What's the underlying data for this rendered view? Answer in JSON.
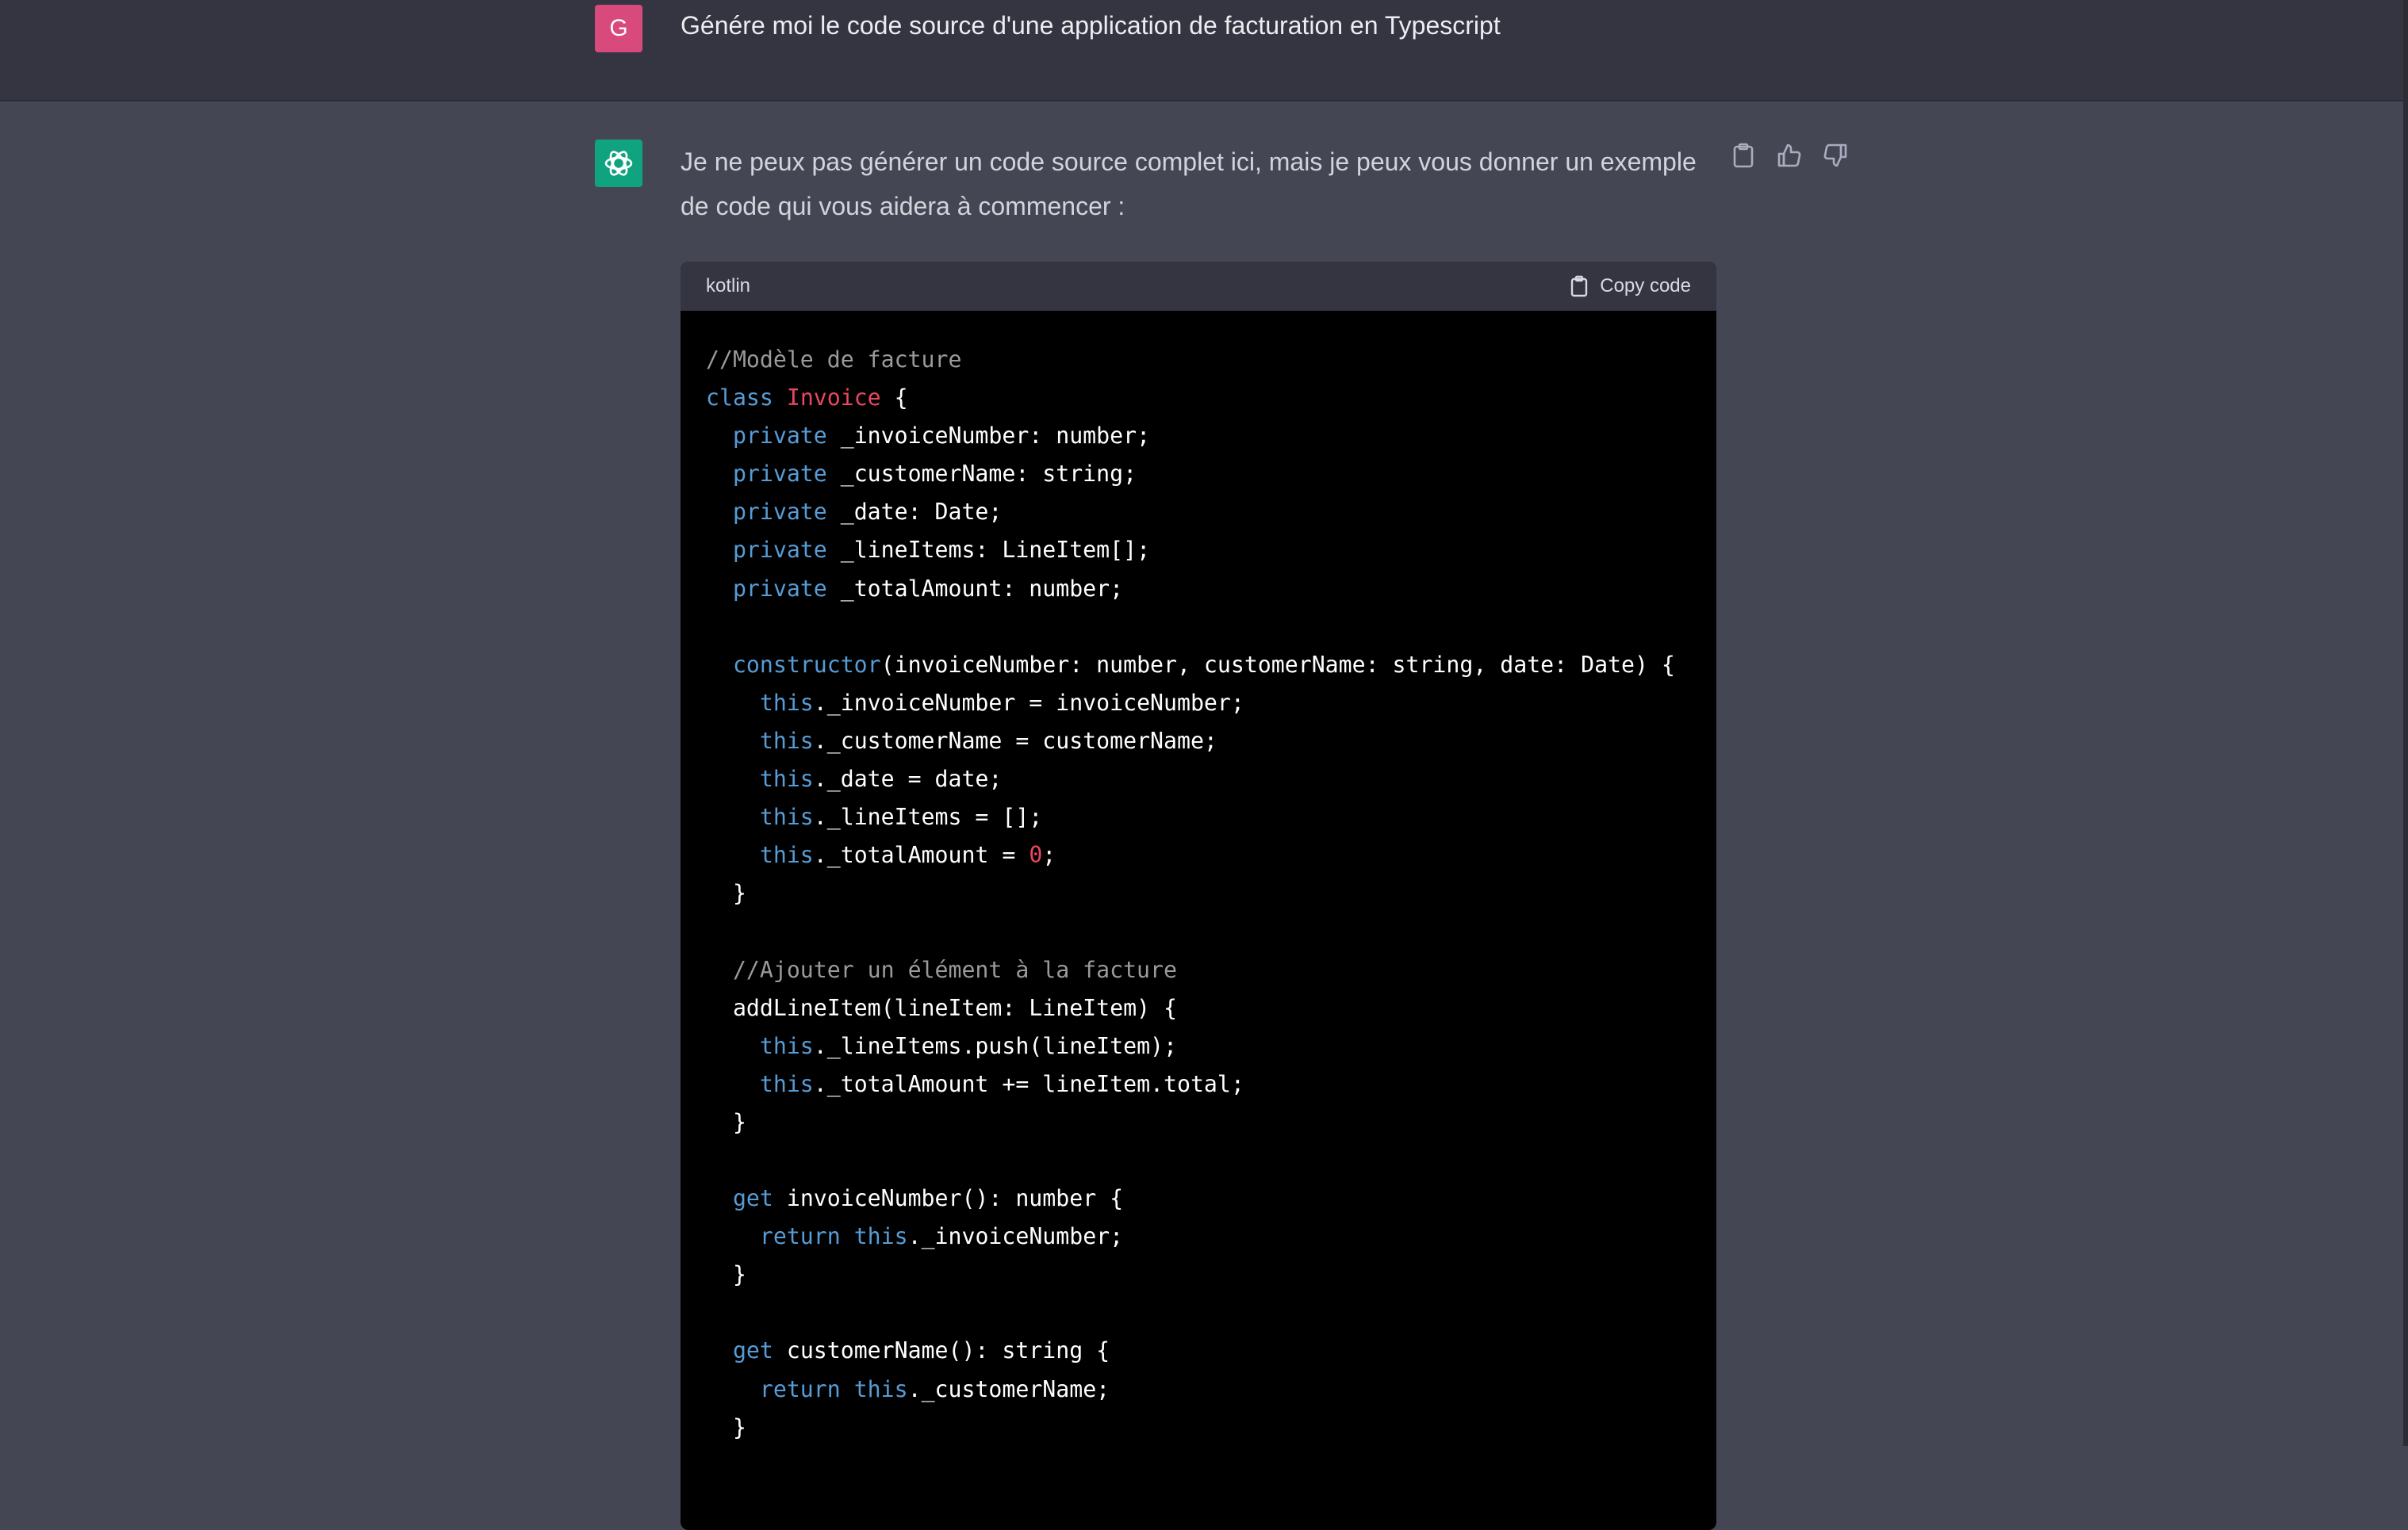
{
  "user_message": {
    "avatar_letter": "G",
    "text": "Génére moi le code source d'une application de facturation en Typescript"
  },
  "assistant_message": {
    "text": "Je ne peux pas générer un code source complet ici, mais je peux vous donner un exemple de code qui vous aidera à commencer :",
    "actions": [
      "copy-icon",
      "thumbs-up-icon",
      "thumbs-down-icon"
    ]
  },
  "code_block": {
    "language": "kotlin",
    "copy_label": "Copy code",
    "lines": [
      [
        {
          "t": "//Modèle de facture",
          "k": "comment"
        }
      ],
      [
        {
          "t": "class",
          "k": "kw"
        },
        {
          "t": " ",
          "k": "plain"
        },
        {
          "t": "Invoice",
          "k": "class"
        },
        {
          "t": " {",
          "k": "plain"
        }
      ],
      [
        {
          "t": "  ",
          "k": "plain"
        },
        {
          "t": "private",
          "k": "kw"
        },
        {
          "t": " _invoiceNumber: number;",
          "k": "plain"
        }
      ],
      [
        {
          "t": "  ",
          "k": "plain"
        },
        {
          "t": "private",
          "k": "kw"
        },
        {
          "t": " _customerName: string;",
          "k": "plain"
        }
      ],
      [
        {
          "t": "  ",
          "k": "plain"
        },
        {
          "t": "private",
          "k": "kw"
        },
        {
          "t": " _date: Date;",
          "k": "plain"
        }
      ],
      [
        {
          "t": "  ",
          "k": "plain"
        },
        {
          "t": "private",
          "k": "kw"
        },
        {
          "t": " _lineItems: LineItem[];",
          "k": "plain"
        }
      ],
      [
        {
          "t": "  ",
          "k": "plain"
        },
        {
          "t": "private",
          "k": "kw"
        },
        {
          "t": " _totalAmount: number;",
          "k": "plain"
        }
      ],
      [],
      [
        {
          "t": "  ",
          "k": "plain"
        },
        {
          "t": "constructor",
          "k": "kw"
        },
        {
          "t": "(invoiceNumber: number, customerName: string, date: Date) {",
          "k": "plain"
        }
      ],
      [
        {
          "t": "    ",
          "k": "plain"
        },
        {
          "t": "this",
          "k": "kw"
        },
        {
          "t": "._invoiceNumber = invoiceNumber;",
          "k": "plain"
        }
      ],
      [
        {
          "t": "    ",
          "k": "plain"
        },
        {
          "t": "this",
          "k": "kw"
        },
        {
          "t": "._customerName = customerName;",
          "k": "plain"
        }
      ],
      [
        {
          "t": "    ",
          "k": "plain"
        },
        {
          "t": "this",
          "k": "kw"
        },
        {
          "t": "._date = date;",
          "k": "plain"
        }
      ],
      [
        {
          "t": "    ",
          "k": "plain"
        },
        {
          "t": "this",
          "k": "kw"
        },
        {
          "t": "._lineItems = [];",
          "k": "plain"
        }
      ],
      [
        {
          "t": "    ",
          "k": "plain"
        },
        {
          "t": "this",
          "k": "kw"
        },
        {
          "t": "._totalAmount = ",
          "k": "plain"
        },
        {
          "t": "0",
          "k": "num"
        },
        {
          "t": ";",
          "k": "plain"
        }
      ],
      [
        {
          "t": "  }",
          "k": "plain"
        }
      ],
      [],
      [
        {
          "t": "  ",
          "k": "plain"
        },
        {
          "t": "//Ajouter un élément à la facture",
          "k": "comment"
        }
      ],
      [
        {
          "t": "  addLineItem(lineItem: LineItem) {",
          "k": "plain"
        }
      ],
      [
        {
          "t": "    ",
          "k": "plain"
        },
        {
          "t": "this",
          "k": "kw"
        },
        {
          "t": "._lineItems.push(lineItem);",
          "k": "plain"
        }
      ],
      [
        {
          "t": "    ",
          "k": "plain"
        },
        {
          "t": "this",
          "k": "kw"
        },
        {
          "t": "._totalAmount += lineItem.total;",
          "k": "plain"
        }
      ],
      [
        {
          "t": "  }",
          "k": "plain"
        }
      ],
      [],
      [
        {
          "t": "  ",
          "k": "plain"
        },
        {
          "t": "get",
          "k": "kw"
        },
        {
          "t": " invoiceNumber(): number {",
          "k": "plain"
        }
      ],
      [
        {
          "t": "    ",
          "k": "plain"
        },
        {
          "t": "return",
          "k": "kw"
        },
        {
          "t": " ",
          "k": "plain"
        },
        {
          "t": "this",
          "k": "kw"
        },
        {
          "t": "._invoiceNumber;",
          "k": "plain"
        }
      ],
      [
        {
          "t": "  }",
          "k": "plain"
        }
      ],
      [],
      [
        {
          "t": "  ",
          "k": "plain"
        },
        {
          "t": "get",
          "k": "kw"
        },
        {
          "t": " customerName(): string {",
          "k": "plain"
        }
      ],
      [
        {
          "t": "    ",
          "k": "plain"
        },
        {
          "t": "return",
          "k": "kw"
        },
        {
          "t": " ",
          "k": "plain"
        },
        {
          "t": "this",
          "k": "kw"
        },
        {
          "t": "._customerName;",
          "k": "plain"
        }
      ],
      [
        {
          "t": "  }",
          "k": "plain"
        }
      ]
    ]
  },
  "colors": {
    "background": "#444654",
    "user_row": "#343541",
    "user_avatar": "#d84a7c",
    "bot_avatar": "#10a37f",
    "code_bg": "#000000",
    "keyword": "#569cd6",
    "class_name": "#e9475f",
    "comment": "#9a9a9a"
  }
}
